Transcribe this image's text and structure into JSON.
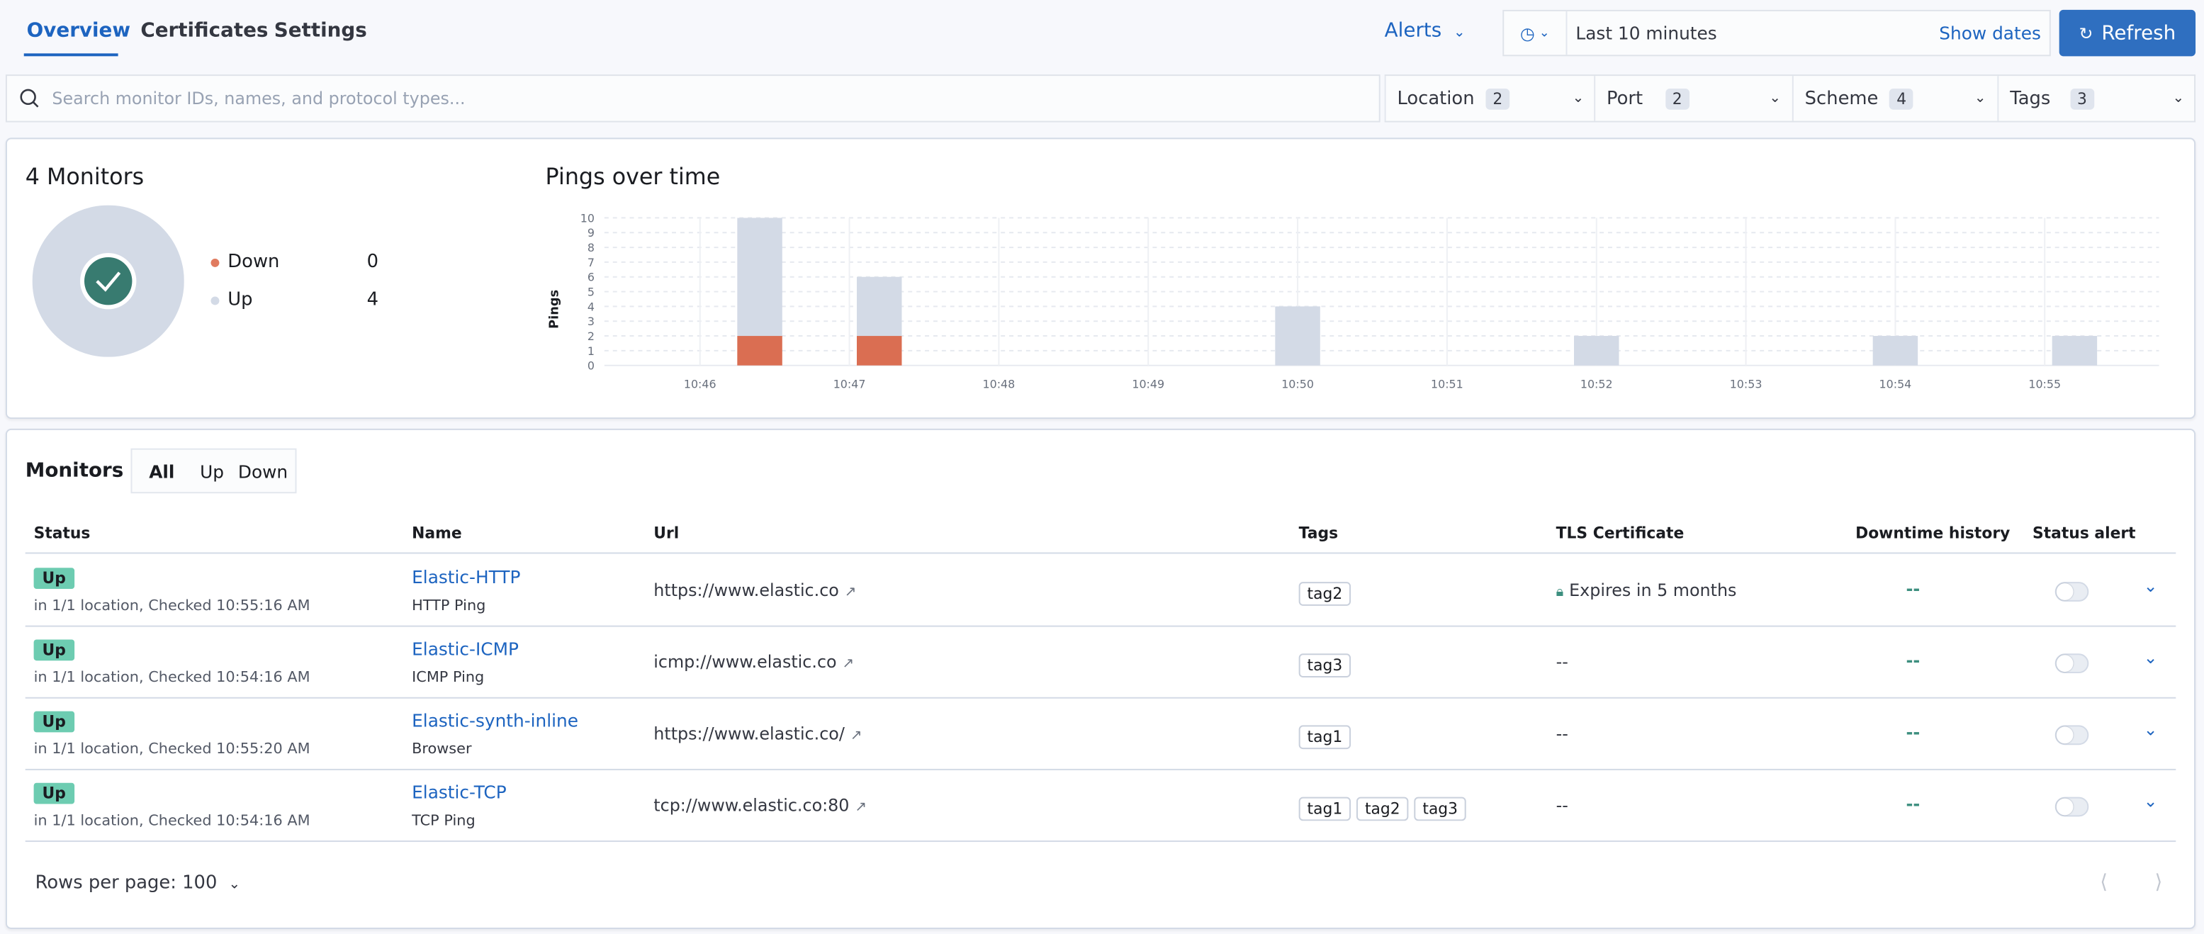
{
  "header": {
    "tabs": [
      {
        "label": "Overview",
        "active": true
      },
      {
        "label": "Certificates"
      },
      {
        "label": "Settings"
      }
    ],
    "alerts_label": "Alerts",
    "date_range": "Last 10 minutes",
    "show_dates_label": "Show dates",
    "refresh_label": "Refresh"
  },
  "search": {
    "placeholder": "Search monitor IDs, names, and protocol types..."
  },
  "filters": [
    {
      "label": "Location",
      "count": "2"
    },
    {
      "label": "Port",
      "count": "2"
    },
    {
      "label": "Scheme",
      "count": "4"
    },
    {
      "label": "Tags",
      "count": "3"
    }
  ],
  "summary": {
    "title": "4 Monitors",
    "legend": [
      {
        "label": "Down",
        "value": "0",
        "color": "#e07b5f"
      },
      {
        "label": "Up",
        "value": "4",
        "color": "#d3dae6"
      }
    ]
  },
  "chart_data": {
    "type": "bar",
    "title": "Pings over time",
    "ylabel": "Pings",
    "ylim": [
      0,
      10
    ],
    "yticks": [
      "0",
      "1",
      "2",
      "3",
      "4",
      "5",
      "6",
      "7",
      "8",
      "9",
      "10"
    ],
    "xticks": [
      "10:46",
      "10:47",
      "10:48",
      "10:49",
      "10:50",
      "10:51",
      "10:52",
      "10:53",
      "10:54",
      "10:55"
    ],
    "stacked": true,
    "grid": true,
    "colors": {
      "down": "#da6e52",
      "up": "#d3dae6"
    },
    "bars": [
      {
        "time": "10:46:24",
        "down": 2,
        "up": 8
      },
      {
        "time": "10:47:12",
        "down": 2,
        "up": 4
      },
      {
        "time": "10:50:00",
        "down": 0,
        "up": 4
      },
      {
        "time": "10:52:00",
        "down": 0,
        "up": 2
      },
      {
        "time": "10:54:00",
        "down": 0,
        "up": 2
      },
      {
        "time": "10:55:12",
        "down": 0,
        "up": 2
      }
    ]
  },
  "monitors": {
    "title": "Monitors",
    "status_filter": [
      {
        "label": "All",
        "active": true
      },
      {
        "label": "Up"
      },
      {
        "label": "Down"
      }
    ],
    "columns": [
      "Status",
      "Name",
      "Url",
      "Tags",
      "TLS Certificate",
      "Downtime history",
      "Status alert"
    ],
    "rows": [
      {
        "status": "Up",
        "detail": "in 1/1 location, Checked 10:55:16 AM",
        "name": "Elastic-HTTP",
        "type": "HTTP Ping",
        "url": "https://www.elastic.co",
        "tags": [
          "tag2"
        ],
        "tls": "Expires in 5 months",
        "downtime": "--"
      },
      {
        "status": "Up",
        "detail": "in 1/1 location, Checked 10:54:16 AM",
        "name": "Elastic-ICMP",
        "type": "ICMP Ping",
        "url": "icmp://www.elastic.co",
        "tags": [
          "tag3"
        ],
        "tls": "--",
        "downtime": "--"
      },
      {
        "status": "Up",
        "detail": "in 1/1 location, Checked 10:55:20 AM",
        "name": "Elastic-synth-inline",
        "type": "Browser",
        "url": "https://www.elastic.co/",
        "tags": [
          "tag1"
        ],
        "tls": "--",
        "downtime": "--"
      },
      {
        "status": "Up",
        "detail": "in 1/1 location, Checked 10:54:16 AM",
        "name": "Elastic-TCP",
        "type": "TCP Ping",
        "url": "tcp://www.elastic.co:80",
        "tags": [
          "tag1",
          "tag2",
          "tag3"
        ],
        "tls": "--",
        "downtime": "--"
      }
    ],
    "rows_per_page": "Rows per page: 100"
  }
}
